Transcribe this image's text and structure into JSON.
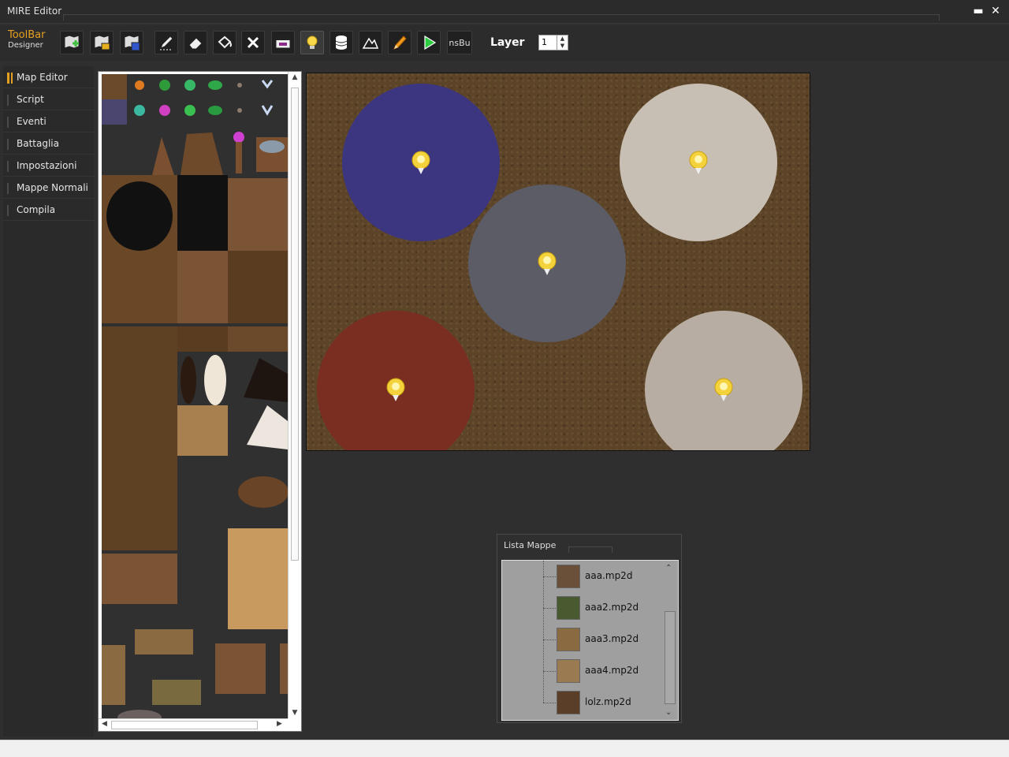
{
  "window": {
    "title": "MIRE Editor",
    "minimize_glyph": "▬",
    "close_glyph": "✕"
  },
  "toolbar": {
    "brand_title": "ToolBar",
    "brand_subtitle": "Designer",
    "buttons": [
      {
        "icon": "new-map-icon"
      },
      {
        "icon": "open-map-icon"
      },
      {
        "icon": "save-map-icon"
      },
      {
        "icon": "pencil-icon"
      },
      {
        "icon": "eraser-icon"
      },
      {
        "icon": "fill-bucket-icon"
      },
      {
        "icon": "delete-icon"
      },
      {
        "icon": "event-layer-icon"
      },
      {
        "icon": "light-bulb-icon"
      },
      {
        "icon": "database-icon"
      },
      {
        "icon": "mountain-icon"
      },
      {
        "icon": "draw-pencil-icon"
      },
      {
        "icon": "play-icon"
      }
    ],
    "ns_button_label": "nsBu",
    "layer_label": "Layer",
    "layer_value": "1"
  },
  "sidebar": {
    "items": [
      {
        "label": "Map Editor",
        "active": true
      },
      {
        "label": "Script",
        "active": false
      },
      {
        "label": "Eventi",
        "active": false
      },
      {
        "label": "Battaglia",
        "active": false
      },
      {
        "label": "Impostazioni",
        "active": false
      },
      {
        "label": "Mappe Normali",
        "active": false
      },
      {
        "label": "Compila",
        "active": false
      }
    ]
  },
  "map": {
    "lights": [
      {
        "color": "#3c3580"
      },
      {
        "color": "#c8bfb4"
      },
      {
        "color": "#5c5c66"
      },
      {
        "color": "#7a2e22"
      },
      {
        "color": "#b8ada2"
      }
    ]
  },
  "map_list": {
    "title": "Lista Mappe",
    "items": [
      {
        "label": "aaa.mp2d"
      },
      {
        "label": "aaa2.mp2d"
      },
      {
        "label": "aaa3.mp2d"
      },
      {
        "label": "aaa4.mp2d"
      },
      {
        "label": "lolz.mp2d"
      }
    ]
  }
}
